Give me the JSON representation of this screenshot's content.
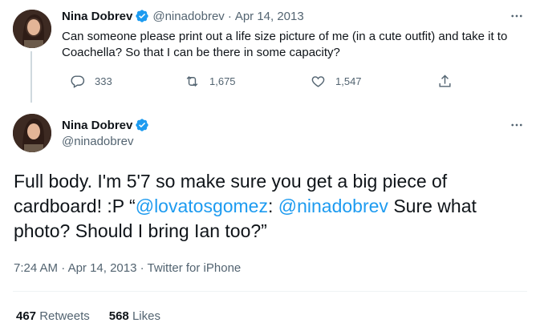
{
  "parent_tweet": {
    "author_name": "Nina Dobrev",
    "author_handle": "@ninadobrev",
    "separator": "·",
    "date": "Apr 14, 2013",
    "text": "Can someone please print out a life size picture of me (in a cute outfit) and take it to Coachella? So that I can be there in some capacity?",
    "replies": "333",
    "retweets": "1,675",
    "likes": "1,547"
  },
  "main_tweet": {
    "author_name": "Nina Dobrev",
    "author_handle": "@ninadobrev",
    "text_before": "Full body. I'm 5'7 so make sure you get a big piece of cardboard! :P “",
    "mention_1": "@lovatosgomez",
    "text_middle": ": ",
    "mention_2": "@ninadobrev",
    "text_after": " Sure what photo? Should I bring Ian too?”",
    "time": "7:24 AM",
    "date": "Apr 14, 2013",
    "source": "Twitter for iPhone",
    "meta_separator": " · ",
    "retweet_count": "467",
    "retweet_label": "Retweets",
    "like_count": "568",
    "like_label": "Likes"
  },
  "icons": {
    "verified": "verified-badge-icon",
    "more": "more-horizontal-icon",
    "reply": "reply-bubble-icon",
    "retweet": "retweet-icon",
    "like": "heart-icon",
    "share": "share-upload-icon"
  },
  "colors": {
    "accent": "#1d9bf0",
    "text_primary": "#0f1419",
    "text_secondary": "#536471",
    "thread_line": "#cfd9de"
  }
}
